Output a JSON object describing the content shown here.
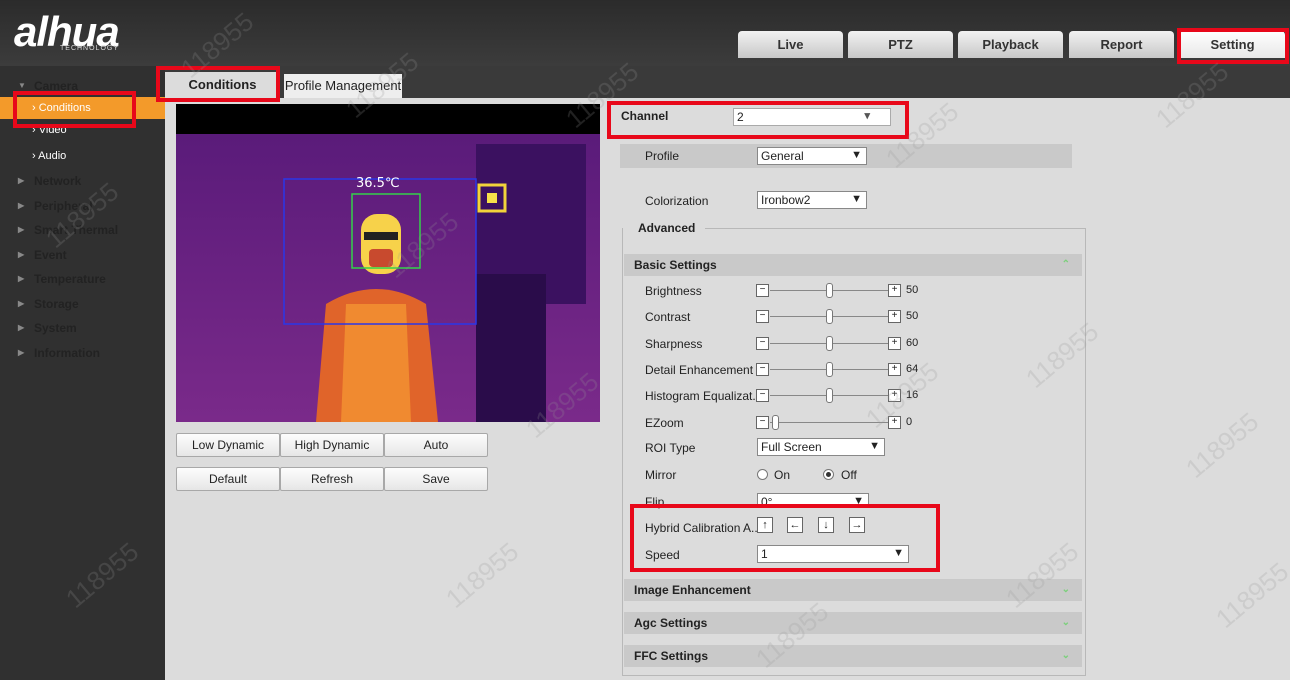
{
  "header": {
    "logo_text": "alhua",
    "logo_sub": "TECHNOLOGY",
    "nav": [
      "Live",
      "PTZ",
      "Playback",
      "Report",
      "Setting"
    ]
  },
  "sidebar": {
    "camera": "Camera",
    "conditions": "Conditions",
    "video": "Video",
    "audio": "Audio",
    "network": "Network",
    "peripheral": "Peripheral",
    "smart_thermal": "Smart Thermal",
    "event": "Event",
    "temperature": "Temperature",
    "storage": "Storage",
    "system": "System",
    "information": "Information"
  },
  "tabs": {
    "conditions": "Conditions",
    "profile_management": "Profile Management"
  },
  "preview": {
    "temperature_label": "36.5℃"
  },
  "buttons": {
    "low_dynamic": "Low Dynamic",
    "high_dynamic": "High Dynamic",
    "auto": "Auto",
    "default": "Default",
    "refresh": "Refresh",
    "save": "Save"
  },
  "form": {
    "channel_label": "Channel",
    "channel_value": "2",
    "profile_label": "Profile",
    "profile_value": "General",
    "colorization_label": "Colorization",
    "colorization_value": "Ironbow2",
    "advanced_label": "Advanced",
    "basic_settings": "Basic Settings",
    "sliders": [
      {
        "label": "Brightness",
        "value": "50"
      },
      {
        "label": "Contrast",
        "value": "50"
      },
      {
        "label": "Sharpness",
        "value": "60"
      },
      {
        "label": "Detail Enhancement",
        "value": "64"
      },
      {
        "label": "Histogram Equalizat...",
        "value": "16"
      },
      {
        "label": "EZoom",
        "value": "0"
      }
    ],
    "roi_label": "ROI Type",
    "roi_value": "Full Screen",
    "mirror_label": "Mirror",
    "mirror_on": "On",
    "mirror_off": "Off",
    "flip_label": "Flip",
    "flip_value": "0°",
    "hybrid_label": "Hybrid Calibration A...",
    "speed_label": "Speed",
    "speed_value": "1",
    "image_enhancement": "Image Enhancement",
    "agc_settings": "Agc Settings",
    "ffc_settings": "FFC Settings"
  },
  "watermark_text": "118955"
}
